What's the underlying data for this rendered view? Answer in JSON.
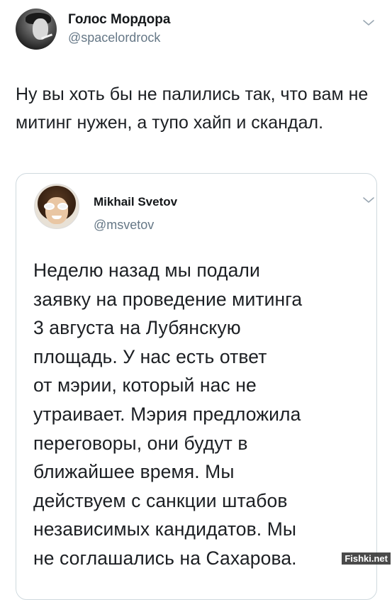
{
  "tweet": {
    "author_name": "Голос Мордора",
    "author_handle": "@spacelordrock",
    "text": "Ну вы хоть бы не палились так, что вам не митинг нужен, а тупо хайп и скандал."
  },
  "quoted_tweet": {
    "author_name": "Mikhail Svetov",
    "author_handle": "@msvetov",
    "text_lines": [
      "Неделю назад мы подали",
      "заявку на проведение митинга",
      "3 августа на Лубянскую",
      "площадь. У нас есть ответ",
      "от мэрии, который нас не",
      "утраивает. Мэрия предложила",
      "переговоры, они будут в",
      "ближайшее время. Мы",
      "действуем с санкции штабов",
      "независимых кандидатов. Мы",
      "не соглашались на Сахарова."
    ]
  },
  "watermark": "Fishki.net",
  "icons": {
    "menu": "chevron-down-icon"
  },
  "colors": {
    "text": "#14171a",
    "secondary": "#657786",
    "border": "#cfd9de"
  }
}
